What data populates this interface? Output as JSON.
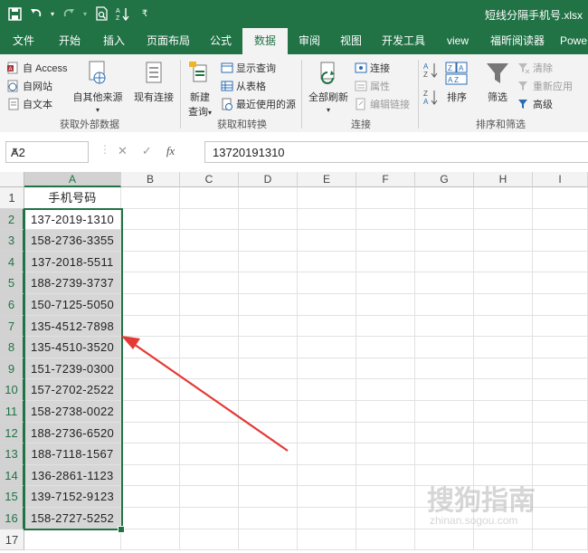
{
  "titlebar": {
    "doc_title": "短线分隔手机号.xlsx",
    "qat": [
      "save-icon",
      "undo-icon",
      "redo-icon",
      "print-preview-icon",
      "sort-icon",
      "customize-qat-icon"
    ]
  },
  "tabs": [
    {
      "label": "文件"
    },
    {
      "label": "开始"
    },
    {
      "label": "插入"
    },
    {
      "label": "页面布局"
    },
    {
      "label": "公式"
    },
    {
      "label": "数据",
      "active": true
    },
    {
      "label": "审阅"
    },
    {
      "label": "视图"
    },
    {
      "label": "开发工具"
    },
    {
      "label": "view"
    },
    {
      "label": "福昕阅读器"
    },
    {
      "label": "Powe"
    }
  ],
  "ribbon": {
    "groups": {
      "external": {
        "label": "获取外部数据",
        "from_access": "自 Access",
        "from_web": "自网站",
        "from_text": "自文本",
        "from_other": "自其他来源",
        "existing": "现有连接"
      },
      "transform": {
        "label": "获取和转换",
        "new_query": "新建",
        "new_query2": "查询",
        "show_queries": "显示查询",
        "from_table": "从表格",
        "recent_sources": "最近使用的源"
      },
      "connections": {
        "label": "连接",
        "refresh_all": "全部刷新",
        "connections": "连接",
        "properties": "属性",
        "edit_links": "编辑链接"
      },
      "sort_filter": {
        "label": "排序和筛选",
        "sort": "排序",
        "filter": "筛选",
        "clear": "清除",
        "reapply": "重新应用",
        "advanced": "高级"
      }
    }
  },
  "formula_bar": {
    "name_box": "A2",
    "formula": "13720191310"
  },
  "grid": {
    "columns": [
      "A",
      "B",
      "C",
      "D",
      "E",
      "F",
      "G",
      "H",
      "I"
    ],
    "rows": [
      "1",
      "2",
      "3",
      "4",
      "5",
      "6",
      "7",
      "8",
      "9",
      "10",
      "11",
      "12",
      "13",
      "14",
      "15",
      "16",
      "17"
    ],
    "col_a_values": [
      "手机号码",
      "137-2019-1310",
      "158-2736-3355",
      "137-2018-5511",
      "188-2739-3737",
      "150-7125-5050",
      "135-4512-7898",
      "135-4510-3520",
      "151-7239-0300",
      "157-2702-2522",
      "158-2738-0022",
      "188-2736-6520",
      "188-7118-1567",
      "136-2861-1123",
      "139-7152-9123",
      "158-2727-5252",
      ""
    ]
  },
  "watermark": {
    "text": "搜狗指南",
    "url": "zhinan.sogou.com"
  },
  "colors": {
    "excel_green": "#217346",
    "arrow_red": "#e53935"
  }
}
